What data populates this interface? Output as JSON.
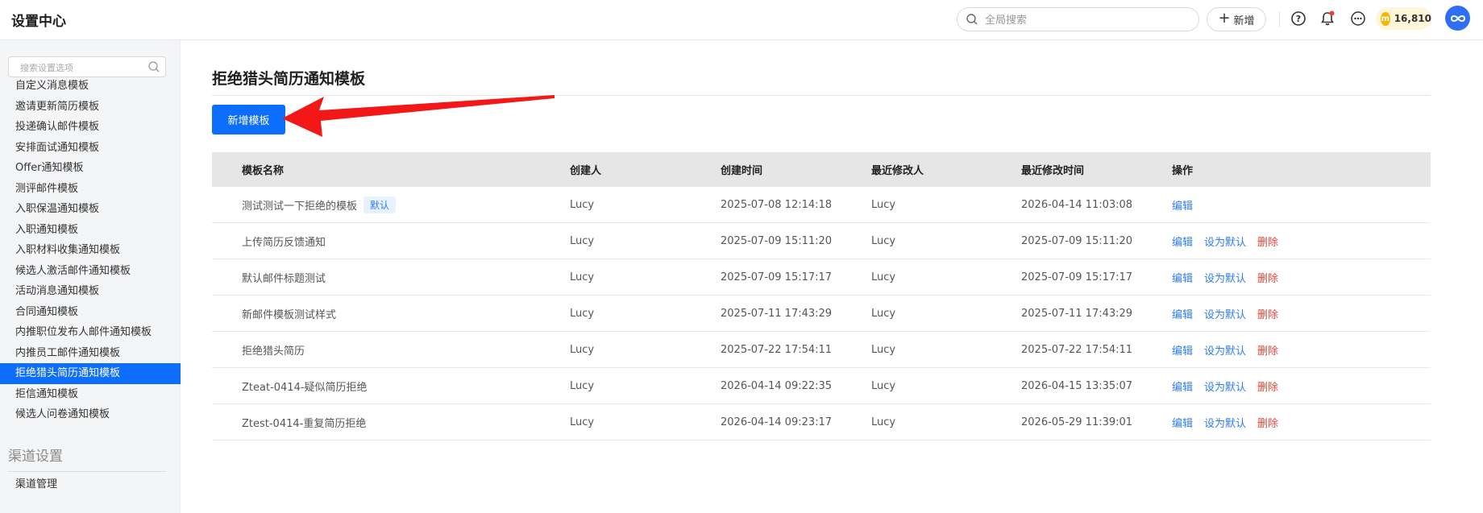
{
  "header": {
    "app_title": "设置中心",
    "search_placeholder": "全局搜索",
    "new_label": "新增",
    "points": "16,810",
    "coin_label": "m"
  },
  "sidebar": {
    "search_placeholder": "搜索设置选项",
    "items": [
      {
        "label": "自定义消息模板",
        "active": false
      },
      {
        "label": "邀请更新简历模板",
        "active": false
      },
      {
        "label": "投递确认邮件模板",
        "active": false
      },
      {
        "label": "安排面试通知模板",
        "active": false
      },
      {
        "label": "Offer通知模板",
        "active": false
      },
      {
        "label": "测评邮件模板",
        "active": false
      },
      {
        "label": "入职保温通知模板",
        "active": false
      },
      {
        "label": "入职通知模板",
        "active": false
      },
      {
        "label": "入职材料收集通知模板",
        "active": false
      },
      {
        "label": "候选人激活邮件通知模板",
        "active": false
      },
      {
        "label": "活动消息通知模板",
        "active": false
      },
      {
        "label": "合同通知模板",
        "active": false
      },
      {
        "label": "内推职位发布人邮件通知模板",
        "active": false
      },
      {
        "label": "内推员工邮件通知模板",
        "active": false
      },
      {
        "label": "拒绝猎头简历通知模板",
        "active": true
      },
      {
        "label": "拒信通知模板",
        "active": false
      },
      {
        "label": "候选人问卷通知模板",
        "active": false
      }
    ],
    "section_title": "渠道设置",
    "channel_item": "渠道管理"
  },
  "main": {
    "title": "拒绝猎头简历通知模板",
    "add_button": "新增模板",
    "columns": [
      "模板名称",
      "创建人",
      "创建时间",
      "最近修改人",
      "最近修改时间",
      "操作"
    ],
    "default_badge": "默认",
    "actions": {
      "edit": "编辑",
      "set_default": "设为默认",
      "delete": "删除"
    },
    "rows": [
      {
        "name": "测试测试一下拒绝的模板",
        "is_default": true,
        "creator": "Lucy",
        "created": "2025-07-08 12:14:18",
        "modifier": "Lucy",
        "modified": "2026-04-14 11:03:08"
      },
      {
        "name": "上传简历反馈通知",
        "is_default": false,
        "creator": "Lucy",
        "created": "2025-07-09 15:11:20",
        "modifier": "Lucy",
        "modified": "2025-07-09 15:11:20"
      },
      {
        "name": "默认邮件标题测试",
        "is_default": false,
        "creator": "Lucy",
        "created": "2025-07-09 15:17:17",
        "modifier": "Lucy",
        "modified": "2025-07-09 15:17:17"
      },
      {
        "name": "新邮件模板测试样式",
        "is_default": false,
        "creator": "Lucy",
        "created": "2025-07-11 17:43:29",
        "modifier": "Lucy",
        "modified": "2025-07-11 17:43:29"
      },
      {
        "name": "拒绝猎头简历",
        "is_default": false,
        "creator": "Lucy",
        "created": "2025-07-22 17:54:11",
        "modifier": "Lucy",
        "modified": "2025-07-22 17:54:11"
      },
      {
        "name": "Zteat-0414-疑似简历拒绝",
        "is_default": false,
        "creator": "Lucy",
        "created": "2026-04-14 09:22:35",
        "modifier": "Lucy",
        "modified": "2026-04-15 13:35:07"
      },
      {
        "name": "Ztest-0414-重复简历拒绝",
        "is_default": false,
        "creator": "Lucy",
        "created": "2026-04-14 09:23:17",
        "modifier": "Lucy",
        "modified": "2026-05-29 11:39:01"
      }
    ]
  },
  "colors": {
    "accent": "#0d6efd",
    "link": "#2f7cf6",
    "danger": "#e9473a",
    "annotation_arrow": "#f21818"
  }
}
